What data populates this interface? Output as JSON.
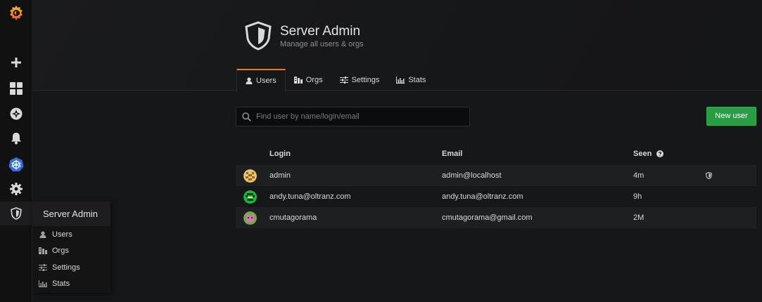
{
  "page": {
    "title": "Server Admin",
    "subtitle": "Manage all users & orgs"
  },
  "tabs": [
    {
      "label": "Users",
      "icon": "user-icon",
      "active": true
    },
    {
      "label": "Orgs",
      "icon": "orgs-icon",
      "active": false
    },
    {
      "label": "Settings",
      "icon": "sliders-icon",
      "active": false
    },
    {
      "label": "Stats",
      "icon": "bar-chart-icon",
      "active": false
    }
  ],
  "search": {
    "placeholder": "Find user by name/login/email",
    "value": ""
  },
  "new_user_label": "New user",
  "table": {
    "columns": {
      "login": "Login",
      "email": "Email",
      "seen": "Seen"
    },
    "rows": [
      {
        "login": "admin",
        "email": "admin@localhost",
        "seen": "4m",
        "is_admin": true,
        "avatar_color": "#8a6a2c"
      },
      {
        "login": "andy.tuna@oltranz.com",
        "email": "andy.tuna@oltranz.com",
        "seen": "9h",
        "is_admin": false,
        "avatar_color": "#1fb43c"
      },
      {
        "login": "cmutagorama",
        "email": "cmutagorama@gmail.com",
        "seen": "2M",
        "is_admin": false,
        "avatar_color": "#b5608a"
      }
    ]
  },
  "sidebar": {
    "items": [
      "grafana-logo-icon",
      "plus-icon",
      "dashboards-icon",
      "explore-icon",
      "alert-bell-icon",
      "kubernetes-icon",
      "gear-icon",
      "shield-icon"
    ],
    "popup": {
      "title": "Server Admin",
      "items": [
        {
          "label": "Users",
          "icon": "user-icon"
        },
        {
          "label": "Orgs",
          "icon": "orgs-icon"
        },
        {
          "label": "Settings",
          "icon": "sliders-icon"
        },
        {
          "label": "Stats",
          "icon": "bar-chart-icon"
        }
      ]
    }
  },
  "colors": {
    "accent": "#eb7b18",
    "primary_button": "#299c46",
    "background": "#161719",
    "kubernetes": "#326ce5"
  }
}
